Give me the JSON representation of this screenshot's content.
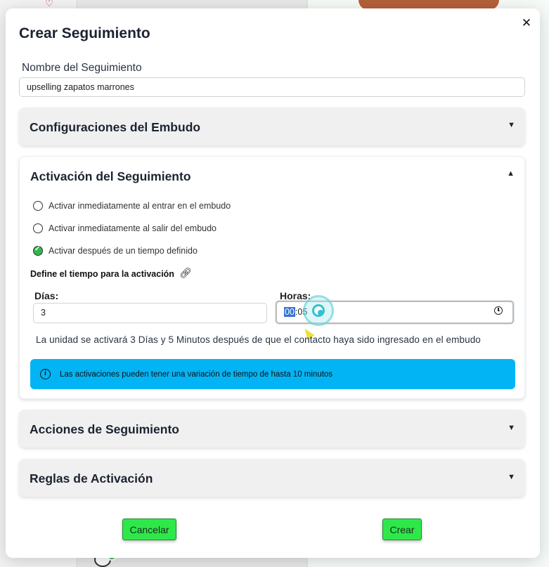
{
  "modal": {
    "title": "Crear Seguimiento",
    "close_label": "✕",
    "name_label": "Nombre del Seguimiento",
    "name_value": "upselling zapatos marrones"
  },
  "sections": {
    "funnel": {
      "title": "Configuraciones del Embudo",
      "icon": "chevron-down-icon"
    },
    "activation": {
      "title": "Activación del Seguimiento",
      "icon": "chevron-up-icon",
      "options": [
        {
          "label": "Activar inmediatamente al entrar en el embudo",
          "checked": false
        },
        {
          "label": "Activar inmediatamente al salir del embudo",
          "checked": false
        },
        {
          "label": "Activar después de un tiempo definido",
          "checked": true
        }
      ],
      "define_label": "Define el tiempo para la activación",
      "define_icon": "link-icon",
      "days_label": "Días:",
      "days_value": "3",
      "hours_label": "Horas:",
      "hours_selected": "00",
      "hours_rest": ":05",
      "note": "La unidad se activará 3 Días y 5 Minutos después de que el contacto haya sido ingresado en el embudo",
      "info_icon": "info-icon",
      "info_text": "Las activaciones pueden tener una variación de tiempo de hasta 10 minutos"
    },
    "actions": {
      "title": "Acciones de Seguimiento",
      "icon": "chevron-down-icon"
    },
    "rules": {
      "title": "Reglas de Activación",
      "icon": "chevron-down-icon"
    }
  },
  "buttons": {
    "cancel": "Cancelar",
    "create": "Crear"
  },
  "colors": {
    "accent_green": "#2ee84a",
    "info_blue": "#03b4f5",
    "check_green": "#2fb84e"
  }
}
